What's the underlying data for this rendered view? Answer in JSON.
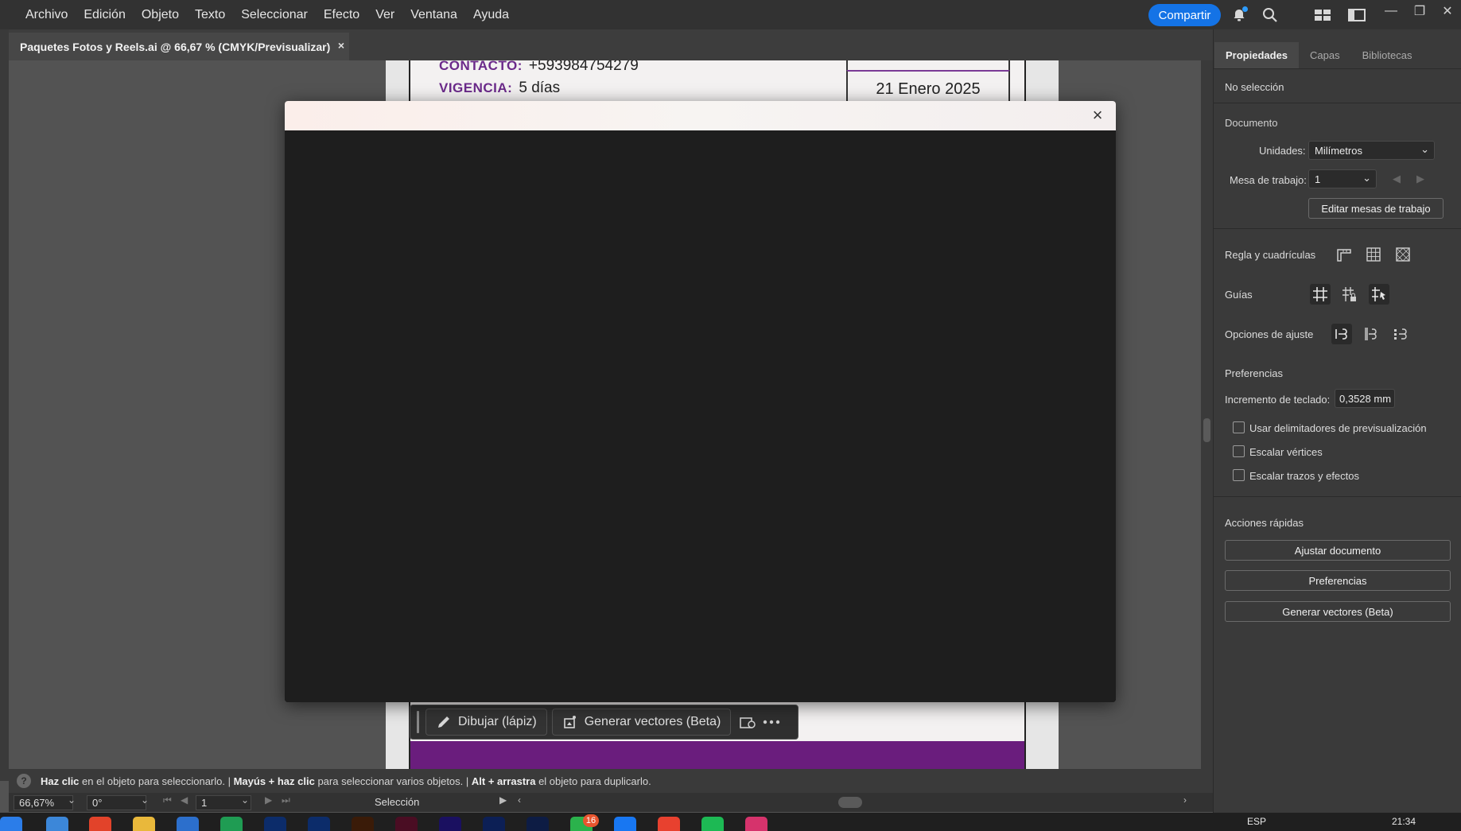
{
  "menubar": {
    "items": [
      "Archivo",
      "Edición",
      "Objeto",
      "Texto",
      "Seleccionar",
      "Efecto",
      "Ver",
      "Ventana",
      "Ayuda"
    ],
    "share_label": "Compartir",
    "icons": [
      "bell-icon",
      "search-icon",
      "arrange-documents-icon",
      "workspace-icon"
    ],
    "window_controls": [
      "minimize",
      "restore",
      "maximize",
      "close"
    ]
  },
  "document_tab": {
    "title": "Paquetes Fotos y Reels.ai @ 66,67 % (CMYK/Previsualizar)",
    "close": "×"
  },
  "artboard": {
    "contact_label": "CONTACTO:",
    "contact_value": "+593984754279",
    "validity_label": "VIGENCIA:",
    "validity_value": "5 días",
    "date": "21 Enero 2025",
    "accent_color": "#6a1d7d"
  },
  "context_bar": {
    "draw_label": "Dibujar (lápiz)",
    "generate_label": "Generar vectores (Beta)"
  },
  "modal": {
    "close": "×"
  },
  "statusbar": {
    "hint_1_bold": "Haz clic",
    "hint_1": " en el objeto para seleccionarlo.  |  ",
    "hint_2_bold": "Mayús + haz clic",
    "hint_2": " para seleccionar varios objetos.  |  ",
    "hint_3_bold": "Alt + arrastra",
    "hint_3": " el objeto para duplicarlo."
  },
  "bottombar": {
    "zoom": "66,67%",
    "rotation": "0°",
    "artboard_number": "1",
    "tool": "Selección"
  },
  "panel": {
    "tabs": [
      "Propiedades",
      "Capas",
      "Bibliotecas"
    ],
    "no_selection": "No selección",
    "document_heading": "Documento",
    "units_label": "Unidades:",
    "units_value": "Milímetros",
    "artboard_label": "Mesa de trabajo:",
    "artboard_value": "1",
    "edit_artboards": "Editar mesas de trabajo",
    "rulers_heading": "Regla y cuadrículas",
    "guides_heading": "Guías",
    "snap_heading": "Opciones de ajuste",
    "prefs_heading": "Preferencias",
    "keyboard_increment_label": "Incremento de teclado:",
    "keyboard_increment_value": "0,3528 mm",
    "check_preview_bounds": "Usar delimitadores de previsualización",
    "check_scale_corners": "Escalar vértices",
    "check_scale_strokes": "Escalar trazos y efectos",
    "quick_actions_heading": "Acciones rápidas",
    "btn_fit_document": "Ajustar documento",
    "btn_preferences": "Preferencias",
    "btn_generate_vectors": "Generar vectores (Beta)"
  },
  "taskbar": {
    "badge": "16",
    "language": "ESP",
    "time": "21:34"
  }
}
